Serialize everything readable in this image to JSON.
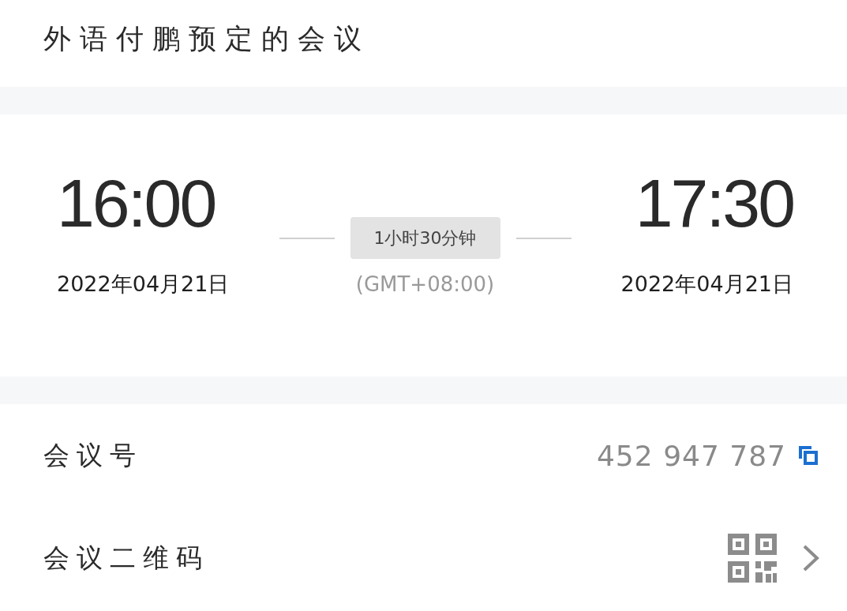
{
  "header": {
    "title": "外语付鹏预定的会议"
  },
  "schedule": {
    "start": {
      "time": "16:00",
      "date": "2022年04月21日"
    },
    "duration": "1小时30分钟",
    "timezone": "(GMT+08:00)",
    "end": {
      "time": "17:30",
      "date": "2022年04月21日"
    }
  },
  "details": [
    {
      "kind": "copy",
      "label": "会议号",
      "value": "452 947 787"
    },
    {
      "kind": "qr",
      "label": "会议二维码"
    }
  ]
}
